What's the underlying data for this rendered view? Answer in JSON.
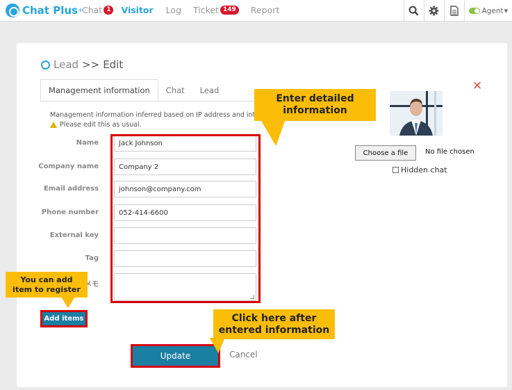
{
  "app": {
    "brand": "Chat Plus",
    "brand_sup": "+"
  },
  "nav": [
    {
      "label": "Chat",
      "badge": "1",
      "active": false
    },
    {
      "label": "Visitor",
      "badge": "",
      "active": true
    },
    {
      "label": "Log",
      "badge": "",
      "active": false
    },
    {
      "label": "Ticket",
      "badge": "149",
      "active": false
    },
    {
      "label": "Report",
      "badge": "",
      "active": false
    }
  ],
  "topbar": {
    "agent_label": "Agent",
    "icons": [
      "search-icon",
      "gear-icon",
      "document-icon"
    ]
  },
  "page": {
    "crumb": "Lead",
    "separator": ">>",
    "current": "Edit"
  },
  "tabs": [
    "Management information",
    "Chat",
    "Lead"
  ],
  "info": {
    "line1": "Management information inferred based on IP address and int",
    "line2": "Please edit this as usual."
  },
  "form": {
    "fields": [
      {
        "label": "Name",
        "value": "Jack Johnson"
      },
      {
        "label": "Company name",
        "value": "Company 2"
      },
      {
        "label": "Email address",
        "value": "johnson@company.com"
      },
      {
        "label": "Phone number",
        "value": "052-414-6600"
      },
      {
        "label": "External key",
        "value": ""
      },
      {
        "label": "Tag",
        "value": ""
      }
    ],
    "memo_label": "メモ"
  },
  "file": {
    "choose_label": "Choose a file",
    "status": "No file chosen",
    "hidden_chat": "Hidden chat"
  },
  "buttons": {
    "add_items": "Add items",
    "update": "Update",
    "cancel": "Cancel"
  },
  "callouts": {
    "detail": [
      "Enter detailed",
      "information"
    ],
    "add": [
      "You can add",
      "item to register"
    ],
    "update": [
      "Click here after",
      "entered information"
    ]
  },
  "colors": {
    "accent": "#2aa5dc",
    "button": "#1b7ea3",
    "highlight": "#d60000",
    "callout": "#fbbd08",
    "badge": "#d9162b"
  }
}
